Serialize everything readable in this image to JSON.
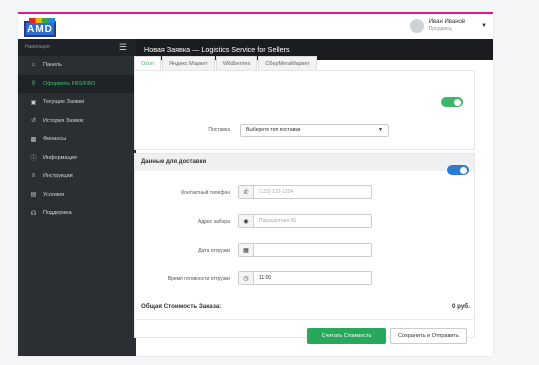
{
  "brand": {
    "logo_text": "AMD"
  },
  "user": {
    "name": "Иван Иванов",
    "role": "Продавец"
  },
  "sidebar": {
    "header": "Навигация",
    "items": [
      {
        "label": "Панель",
        "icon": "home-icon"
      },
      {
        "label": "Оформить FBS/FBO",
        "icon": "cart-icon",
        "active": true
      },
      {
        "label": "Текущие Заявки",
        "icon": "box-icon"
      },
      {
        "label": "История Заявок",
        "icon": "history-icon"
      },
      {
        "label": "Финансы",
        "icon": "finance-icon"
      },
      {
        "label": "Информация",
        "icon": "info-icon"
      },
      {
        "label": "Инструкции",
        "icon": "list-icon"
      },
      {
        "label": "Условия",
        "icon": "document-icon"
      },
      {
        "label": "Поддержка",
        "icon": "headset-icon"
      }
    ]
  },
  "page": {
    "title": "Новая Заявка — Logistics Service for Sellers"
  },
  "tabs": [
    "Ozon",
    "Яндекс Маркет",
    "Wildberries",
    "СберМегаМаркет"
  ],
  "supply": {
    "label": "Поставка",
    "select_value": "Выберите тип поставки"
  },
  "delivery": {
    "title": "Данные для доставки",
    "phone": {
      "label": "Контактный телефон",
      "placeholder": "(123) 123-1234"
    },
    "address": {
      "label": "Адрес забора",
      "placeholder": "Парашютная 56"
    },
    "date": {
      "label": "Дата отгрузки",
      "value": ""
    },
    "time": {
      "label": "Время готовности отгрузки",
      "value": "11:00"
    }
  },
  "total": {
    "label": "Общая Стоимость Заказа:",
    "value": "0 руб."
  },
  "buttons": {
    "calc": "Считать Стоимость",
    "save": "Сохранить и Отправить"
  },
  "colors": {
    "accent_green": "#27a85a",
    "accent_blue": "#2f7ad1",
    "topbar_accent": "#d81b8a",
    "sidebar_bg": "#2b2e33"
  }
}
